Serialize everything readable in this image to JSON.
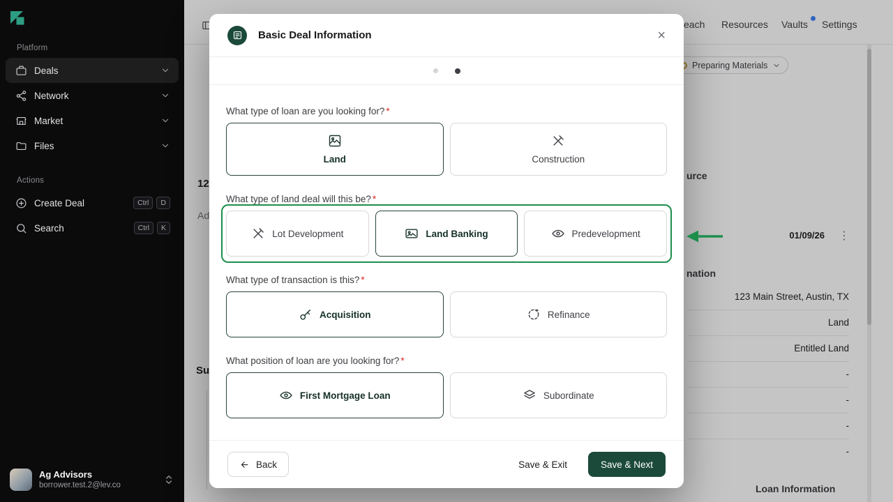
{
  "colors": {
    "primary_green": "#1b4a3a",
    "annotation_green": "#1e8e4d",
    "vaults_badge_blue": "#3b82f6",
    "required_red": "#dc2626"
  },
  "sidebar": {
    "platform_label": "Platform",
    "items": [
      {
        "label": "Deals",
        "active": true
      },
      {
        "label": "Network",
        "active": false
      },
      {
        "label": "Market",
        "active": false
      },
      {
        "label": "Files",
        "active": false
      }
    ],
    "actions_label": "Actions",
    "actions": [
      {
        "label": "Create Deal",
        "keys": [
          "Ctrl",
          "D"
        ]
      },
      {
        "label": "Search",
        "keys": [
          "Ctrl",
          "K"
        ]
      }
    ],
    "user": {
      "name": "Ag Advisors",
      "email": "borrower.test.2@lev.co"
    }
  },
  "topnav": {
    "items": [
      "each",
      "Resources",
      "Vaults",
      "Settings"
    ],
    "vaults_has_badge": true
  },
  "background": {
    "status_pill": "Preparing Materials",
    "left": {
      "heading": "12",
      "subtext": "Ad",
      "section": "Su"
    },
    "right": {
      "source_header": "urce",
      "date": "01/09/26",
      "kebab": "⋮",
      "info_header": "nation",
      "rows": [
        "123 Main Street, Austin, TX",
        "Land",
        "Entitled Land",
        "-",
        "-",
        "-",
        "-"
      ],
      "loan_header": "Loan Information"
    }
  },
  "modal": {
    "title": "Basic Deal Information",
    "close": "×",
    "steps": {
      "count": 2,
      "active_index": 1
    },
    "questions": [
      {
        "label": "What type of loan are you looking for?",
        "required": "*",
        "options": [
          {
            "label": "Land",
            "selected": true
          },
          {
            "label": "Construction",
            "selected": false
          }
        ]
      },
      {
        "label": "What type of land deal will this be?",
        "required": "*",
        "options": [
          {
            "label": "Lot Development",
            "selected": false
          },
          {
            "label": "Land Banking",
            "selected": true
          },
          {
            "label": "Predevelopment",
            "selected": false
          }
        ]
      },
      {
        "label": "What type of transaction is this?",
        "required": "*",
        "options": [
          {
            "label": "Acquisition",
            "selected": true
          },
          {
            "label": "Refinance",
            "selected": false
          }
        ]
      },
      {
        "label": "What position of loan are you looking for?",
        "required": "*",
        "options": [
          {
            "label": "First Mortgage Loan",
            "selected": true
          },
          {
            "label": "Subordinate",
            "selected": false
          }
        ]
      }
    ],
    "footer": {
      "back": "Back",
      "save_exit": "Save & Exit",
      "save_next": "Save & Next"
    }
  }
}
